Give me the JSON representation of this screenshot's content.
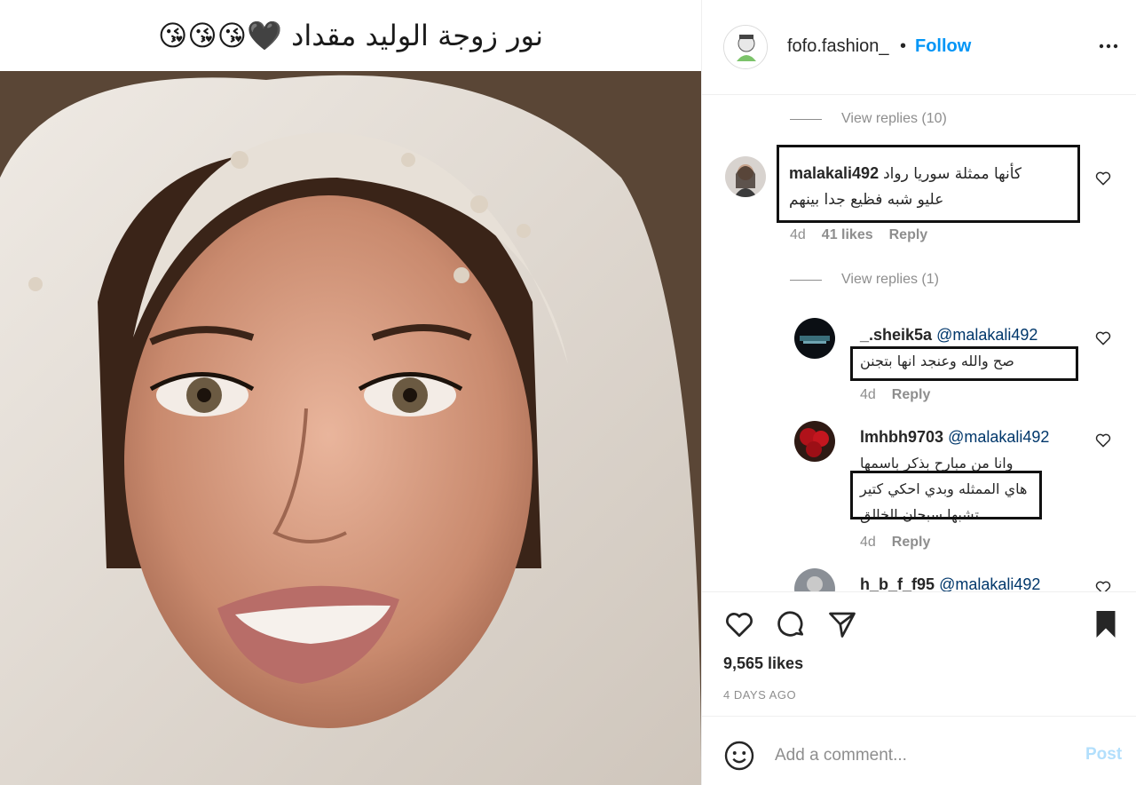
{
  "post": {
    "caption": "نور زوجة الوليد مقداد 🖤😘😘😘"
  },
  "header": {
    "username": "fofo.fashion_",
    "separator": "•",
    "follow_label": "Follow"
  },
  "comments": {
    "view_replies_top": "View replies (10)",
    "main": {
      "username": "malakali492",
      "text_line1": "كأنها ممثلة سوريا رواد",
      "text_line2": "عليو شبه فظيع جدا بينهم",
      "age": "4d",
      "likes": "41 likes",
      "reply_label": "Reply"
    },
    "view_replies_main": "View replies (1)",
    "replies": [
      {
        "username": "_.sheik5a",
        "mention": "@malakali492",
        "text": "صح والله وعنجد انها بتجنن",
        "age": "4d",
        "reply_label": "Reply"
      },
      {
        "username": "lmhbh9703",
        "mention": "@malakali492",
        "text_line1": "وانا من مبارح بذكر باسمها",
        "text_line2": "هاي الممثله وبدي احكي كتير",
        "text_line3": "تشبها سبحان الخالق",
        "age": "4d",
        "reply_label": "Reply"
      },
      {
        "username": "h_b_f_f95",
        "mention": "@malakali492"
      }
    ]
  },
  "actions": {
    "likes": "9,565 likes",
    "time_ago": "4 DAYS AGO"
  },
  "add_comment": {
    "placeholder": "Add a comment...",
    "post_label": "Post"
  },
  "colors": {
    "link_blue": "#0095f6",
    "post_disabled": "#b2dffc",
    "muted": "#8e8e8e",
    "mention": "#00376b"
  },
  "icons": [
    "more-icon",
    "heart-icon",
    "comment-icon",
    "share-icon",
    "bookmark-icon",
    "emoji-icon"
  ]
}
